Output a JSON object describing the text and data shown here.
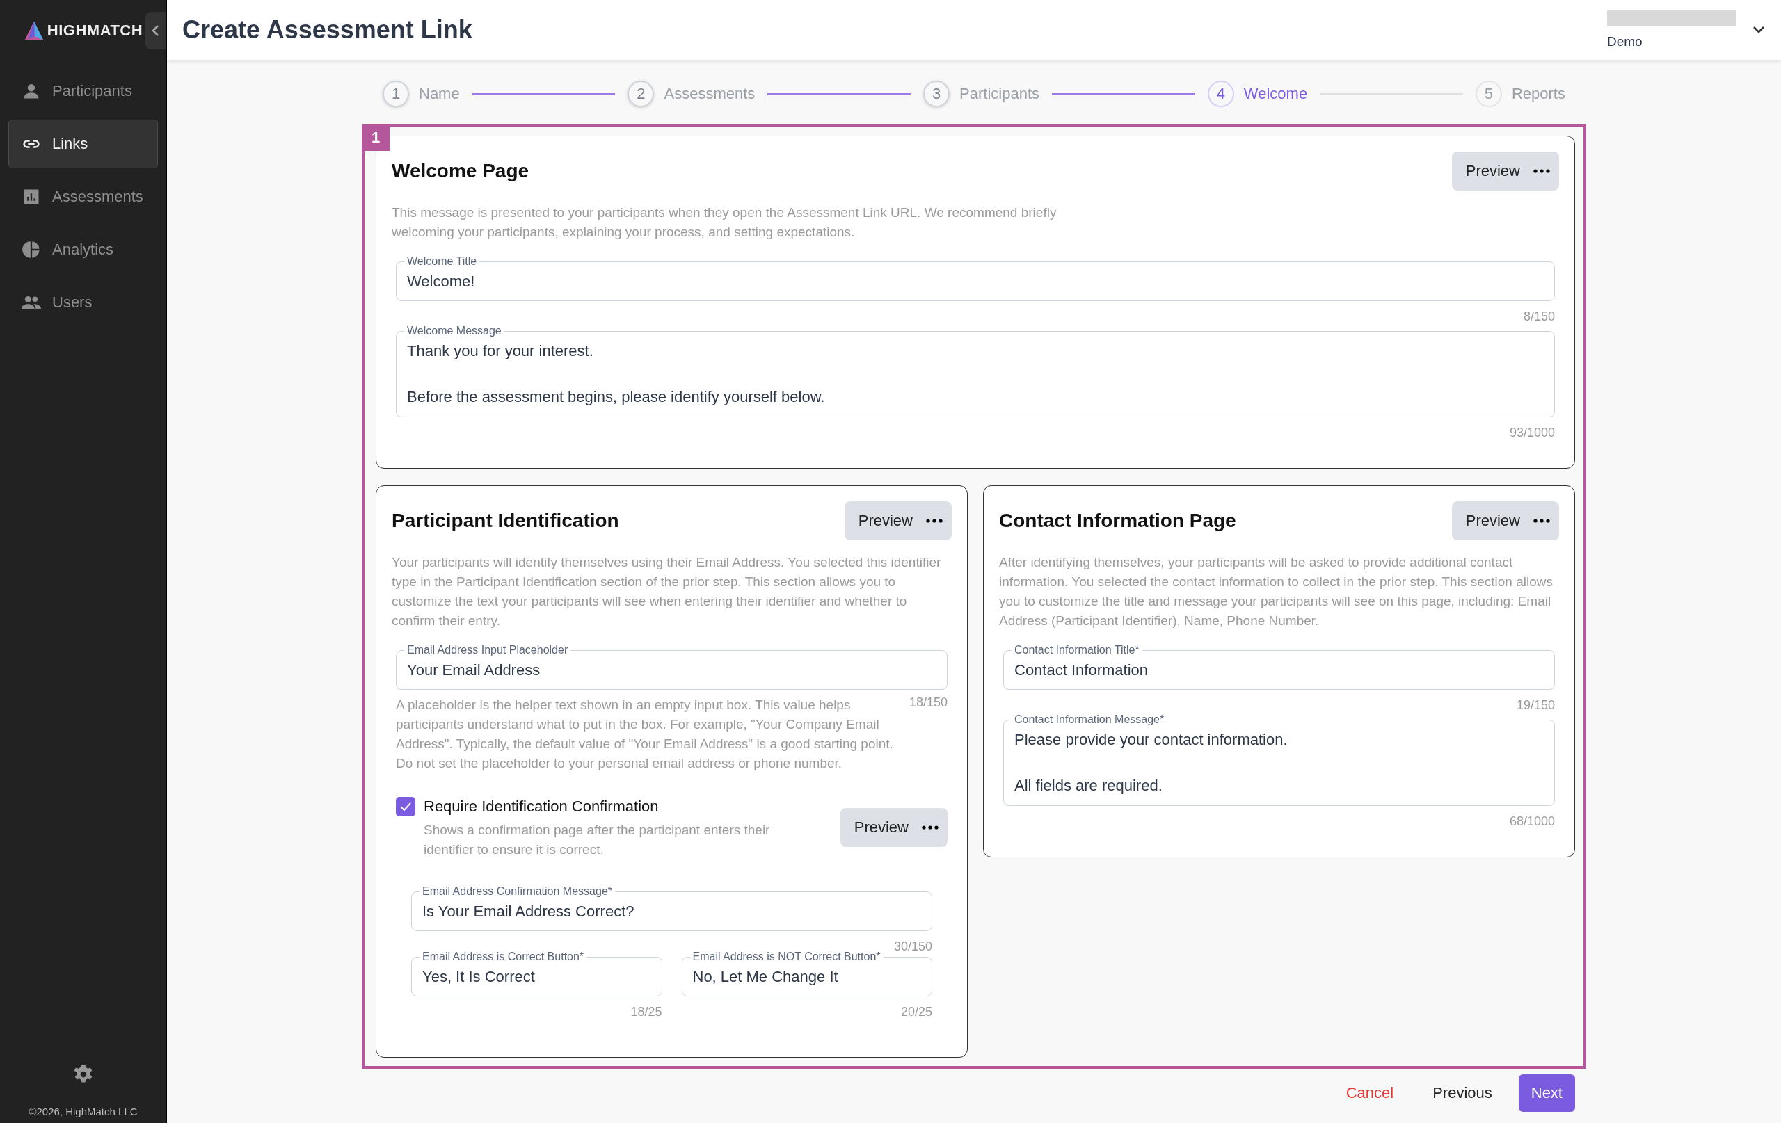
{
  "sidebar": {
    "logo": "HIGHMATCH",
    "items": [
      {
        "label": "Participants",
        "selected": false
      },
      {
        "label": "Links",
        "selected": true
      },
      {
        "label": "Assessments",
        "selected": false
      },
      {
        "label": "Analytics",
        "selected": false
      },
      {
        "label": "Users",
        "selected": false
      }
    ],
    "footer": "©2026, HighMatch LLC"
  },
  "header": {
    "title": "Create Assessment Link",
    "account": "Demo"
  },
  "steps": [
    {
      "number": "1",
      "label": "Name",
      "completed": true,
      "selected": false
    },
    {
      "number": "2",
      "label": "Assessments",
      "completed": true,
      "selected": false
    },
    {
      "number": "3",
      "label": "Participants",
      "completed": true,
      "selected": false
    },
    {
      "number": "4",
      "label": "Welcome",
      "completed": false,
      "selected": true
    },
    {
      "number": "5",
      "label": "Reports",
      "completed": false,
      "selected": false
    }
  ],
  "highlight_badge": "1",
  "welcome_card": {
    "title": "Welcome Page",
    "preview": "Preview",
    "description": "This message is presented to your participants when they open the Assessment Link URL. We recommend briefly welcoming your participants, explaining your process, and setting expectations.",
    "fields": [
      {
        "kind": "text",
        "label": "Welcome Title",
        "value": "Welcome!",
        "counter": "8/150"
      },
      {
        "kind": "textarea",
        "label": "Welcome Message",
        "value": "Thank you for your interest.\n\nBefore the assessment begins, please identify yourself below.",
        "counter": "93/1000"
      }
    ]
  },
  "identification_card": {
    "title": "Participant Identification",
    "preview": "Preview",
    "description": "Your participants will identify themselves using their Email Address. You selected this identifier type in the Participant Identification section of the prior step. This section allows you to customize the text your participants will see when entering their identifier and whether to confirm their entry.",
    "field": {
      "kind": "text",
      "label": "Email Address Input Placeholder",
      "value": "Your Email Address",
      "counter": "18/150"
    },
    "helper": "A placeholder is the helper text shown in an empty input box. This value helps participants understand what to put in the box. For example, \"Your Company Email Address\". Typically, the default value of \"Your Email Address\" is a good starting point. Do not set the placeholder to your personal email address or phone number.",
    "confirmation": {
      "checked": true,
      "label": "Require Identification Confirmation",
      "description": "Shows a confirmation page after the participant enters their identifier to ensure it is correct.",
      "preview": "Preview",
      "message_field": {
        "kind": "text",
        "label": "Email Address Confirmation Message*",
        "value": "Is Your Email Address Correct?",
        "counter": "30/150"
      },
      "button_fields": [
        {
          "kind": "text",
          "label": "Email Address is Correct Button*",
          "value": "Yes, It Is Correct",
          "counter": "18/25"
        },
        {
          "kind": "text",
          "label": "Email Address is NOT Correct Button*",
          "value": "No, Let Me Change It",
          "counter": "20/25"
        }
      ]
    }
  },
  "contact_card": {
    "title": "Contact Information Page",
    "preview": "Preview",
    "description": "After identifying themselves, your participants will be asked to provide additional contact information. You selected the contact information to collect in the prior step. This section allows you to customize the title and message your participants will see on this page, including: Email Address (Participant Identifier), Name, Phone Number.",
    "fields": [
      {
        "kind": "text",
        "label": "Contact Information Title*",
        "value": "Contact Information",
        "counter": "19/150"
      },
      {
        "kind": "textarea",
        "label": "Contact Information Message*",
        "value": "Please provide your contact information.\n\nAll fields are required.",
        "counter": "68/1000"
      }
    ]
  },
  "footer_buttons": {
    "cancel": "Cancel",
    "previous": "Previous",
    "next": "Next"
  }
}
